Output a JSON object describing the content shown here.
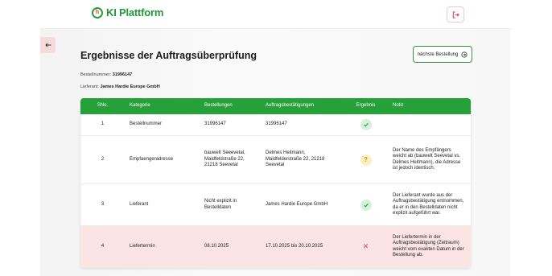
{
  "app": {
    "logo_mark": "h",
    "logo_text": "KI Plattform"
  },
  "header": {
    "logout_icon": "logout-icon"
  },
  "page": {
    "title": "Ergebnisse der Auftragsüberprüfung",
    "next_button_label": "nächste Bestellung",
    "order_label": "Bestellnummer:",
    "order_value": "31996147",
    "supplier_label": "Lieferant:",
    "supplier_value": "James Hardie Europe GmbH"
  },
  "table": {
    "headers": [
      "SNo.",
      "Kategorie",
      "Bestellungen",
      "Auftragsbestätigungen",
      "Ergebnis",
      "Notiz"
    ],
    "rows": [
      {
        "sno": "1",
        "kategorie": "Bestellnummer",
        "bestellungen": "31996147",
        "auftrag": "31996147",
        "ergebnis": "ok",
        "notiz": ""
      },
      {
        "sno": "2",
        "kategorie": "Empfaengeradresse",
        "bestellungen": "bauwelt Seeevetal, Maldfeldstraße 22, 21218 Seevetal",
        "auftrag": "Delmes Heitmann, Maldfelderstraße 22, 21218 Seevetal",
        "ergebnis": "warn",
        "ergebnis_symbol": "?",
        "notiz": "Der Name des Empfängers weicht ab (bauwelt Seevetal vs. Delmes Heitmann), die Adresse ist jedoch identisch."
      },
      {
        "sno": "3",
        "kategorie": "Lieferant",
        "bestellungen": "Nicht explizit in Bestelldaten",
        "auftrag": "James Hardie Europe GmbH",
        "ergebnis": "ok",
        "notiz": "Der Lieferant wurde aus der Auftragsbestätigung entnommen, da er in den Bestelldaten nicht explizit aufgeführt war."
      },
      {
        "sno": "4",
        "kategorie": "Liefertermin",
        "bestellungen": "08.10.2025",
        "auftrag": "17.10.2025 bis 20.10.2025",
        "ergebnis": "fail",
        "ergebnis_symbol": "✕",
        "notiz": "Der Liefertermin in der Auftragsbestätigung (Zeitraum) weicht vom exakten Datum in der Bestellung ab."
      }
    ]
  },
  "colors": {
    "brand_green": "#26a038",
    "alert_row": "#fde4e4",
    "warn": "#fcefc2",
    "fail": "#d94a4a"
  }
}
